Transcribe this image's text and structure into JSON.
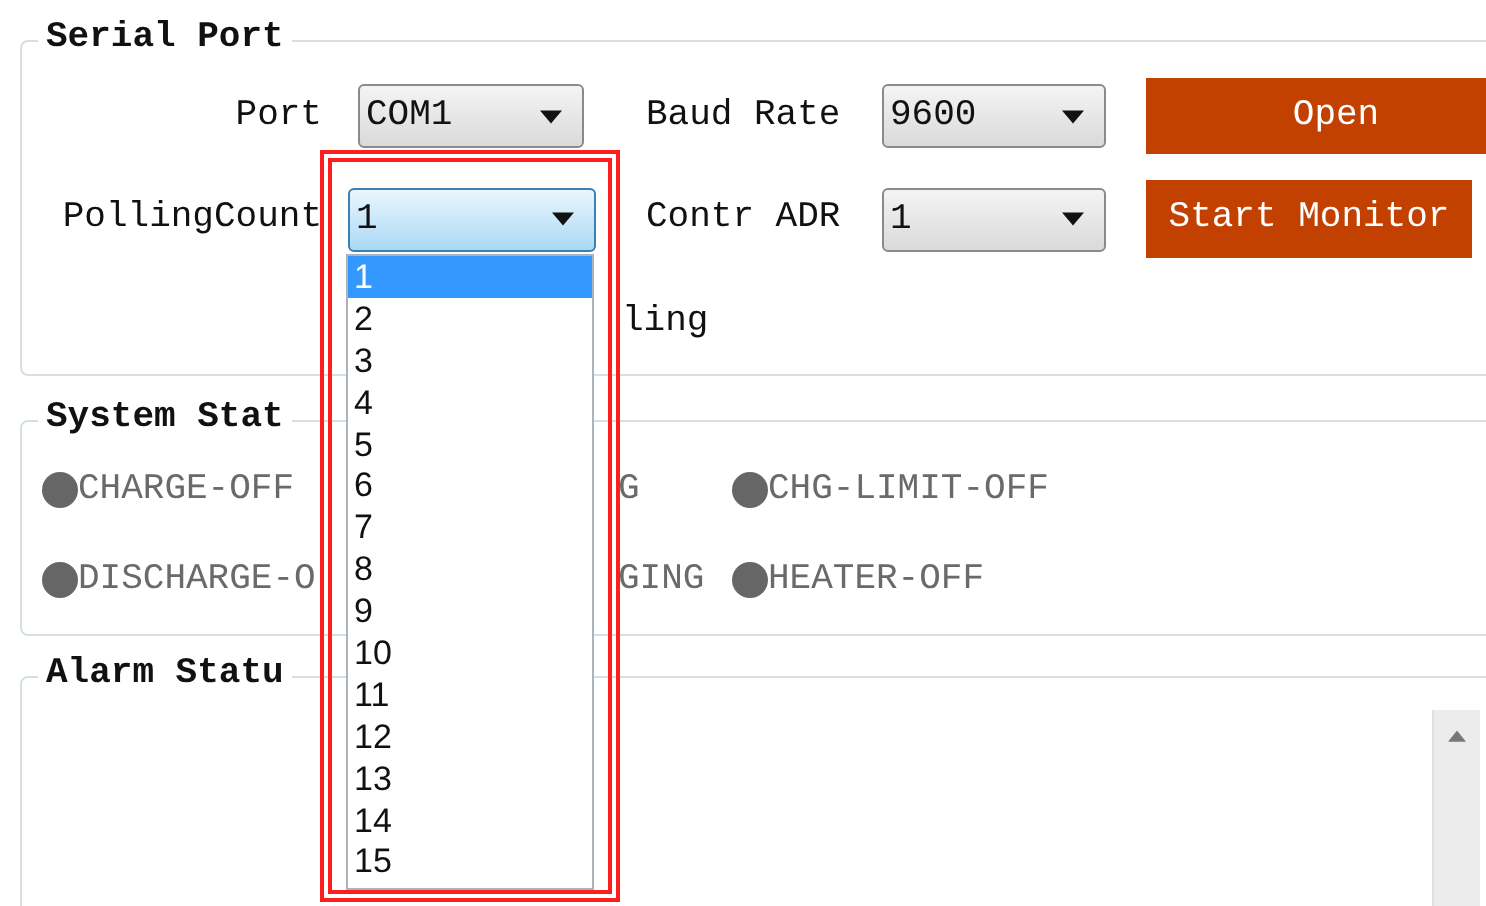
{
  "serial_port": {
    "title": "Serial Port",
    "port": {
      "label": "Port",
      "value": "COM1"
    },
    "baud_rate": {
      "label": "Baud Rate",
      "value": "9600"
    },
    "open_button": "Open",
    "polling_count": {
      "label": "PollingCount",
      "value": "1",
      "expanded": true,
      "options": [
        {
          "label": "1",
          "selected": true
        },
        {
          "label": "2",
          "selected": false
        },
        {
          "label": "3",
          "selected": false
        },
        {
          "label": "4",
          "selected": false
        },
        {
          "label": "5",
          "selected": false
        },
        {
          "label": "6",
          "selected": false
        },
        {
          "label": "7",
          "selected": false
        },
        {
          "label": "8",
          "selected": false
        },
        {
          "label": "9",
          "selected": false
        },
        {
          "label": "10",
          "selected": false
        },
        {
          "label": "11",
          "selected": false
        },
        {
          "label": "12",
          "selected": false
        },
        {
          "label": "13",
          "selected": false
        },
        {
          "label": "14",
          "selected": false
        },
        {
          "label": "15",
          "selected": false
        }
      ]
    },
    "contr_adr": {
      "label": "Contr ADR",
      "value": "1"
    },
    "start_monitor_button": "Start Monitor",
    "partial_label": "ling"
  },
  "system_status": {
    "title": "System Stat",
    "rows": [
      [
        {
          "label": "CHARGE-OFF",
          "color": "#666666"
        },
        {
          "label": "G"
        },
        {
          "label": "CHG-LIMIT-OFF",
          "color": "#666666"
        }
      ],
      [
        {
          "label": "DISCHARGE-O",
          "color": "#666666"
        },
        {
          "label": "GING"
        },
        {
          "label": "HEATER-OFF",
          "color": "#666666"
        }
      ]
    ]
  },
  "alarm_status": {
    "title": "Alarm Statu"
  }
}
